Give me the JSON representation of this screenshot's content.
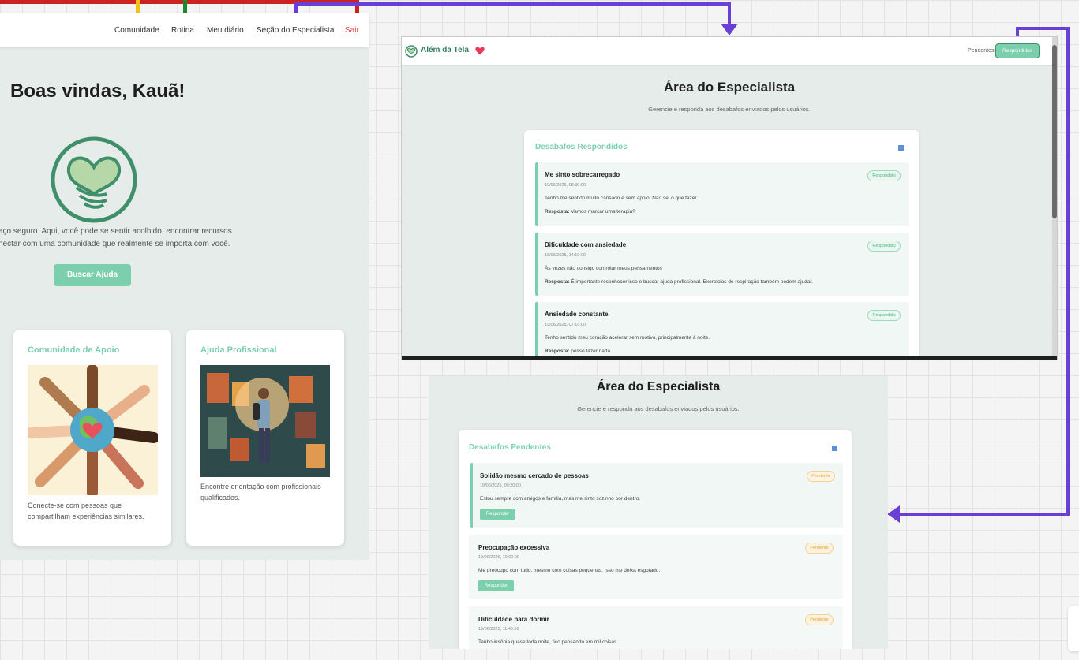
{
  "home": {
    "nav": {
      "comunidade": "Comunidade",
      "rotina": "Rotina",
      "diario": "Meu diário",
      "especialista": "Seção do Especialista",
      "sair": "Sair"
    },
    "title": "Boas vindas, Kauã!",
    "intro_line1": "aço seguro. Aqui, você pode se sentir acolhido, encontrar recursos",
    "intro_line2": "nectar com uma comunidade que realmente se importa com você.",
    "cta": "Buscar Ajuda",
    "cards": [
      {
        "title": "Comunidade de Apoio",
        "desc_line1": "Conecte-se com pessoas que",
        "desc_line2": "compartilham experiências similares."
      },
      {
        "title": "Ajuda Profissional",
        "desc_line1": "Encontre orientação com profissionais",
        "desc_line2": "qualificados."
      }
    ]
  },
  "specialist_answered": {
    "brand": "Além da Tela",
    "tab_pending": "Pendentes",
    "tab_answered": "Respondidos",
    "title": "Área do Especialista",
    "subtitle": "Gerencie e responda aos desabafos enviados pelos usuários.",
    "panel_title": "Desabafos Respondidos",
    "response_label": "Resposta:",
    "items": [
      {
        "title": "Me sinto sobrecarregado",
        "date": "19/06/2025, 08:30:00",
        "text": "Tenho me sentido muito cansado e sem apoio. Não sei o que fazer.",
        "response": "Vamos marcar uma terapia?",
        "status": "Respondido"
      },
      {
        "title": "Dificuldade com ansiedade",
        "date": "18/06/2025, 14:10:00",
        "text": "Às vezes não consigo controlar meus pensamentos",
        "response": "É importante reconhecer isso e buscar ajuda profissional. Exercícios de respiração também podem ajudar.",
        "status": "Respondido"
      },
      {
        "title": "Ansiedade constante",
        "date": "19/06/2025, 07:15:00",
        "text": "Tenho sentido meu coração acelerar sem motivo, principalmente à noite.",
        "response": "posso fazer nada",
        "status": "Respondido"
      }
    ]
  },
  "specialist_pending": {
    "title": "Área do Especialista",
    "subtitle": "Gerencie e responda aos desabafos enviados pelos usuários.",
    "panel_title": "Desabafos Pendentes",
    "reply_label": "Responder",
    "items": [
      {
        "title": "Solidão mesmo cercado de pessoas",
        "date": "19/06/2025, 09:20:00",
        "text": "Estou sempre com amigos e família, mas me sinto sozinho por dentro.",
        "status": "Pendente"
      },
      {
        "title": "Preocupação excessiva",
        "date": "19/06/2025, 10:00:00",
        "text": "Me preocupo com tudo, mesmo com coisas pequenas. Isso me deixa esgotado.",
        "status": "Pendente"
      },
      {
        "title": "Dificuldade para dormir",
        "date": "19/06/2025, 11:45:00",
        "text": "Tenho insônia quase toda noite, fico pensando em mil coisas.",
        "status": "Pendente"
      }
    ]
  },
  "colors": {
    "accent": "#7ccfae",
    "button": "#7bcfad",
    "connector": "#6a3fd6",
    "sair": "#e24b4b",
    "pending_badge": "#e0a53c"
  },
  "icons": [
    "heart-hands-logo",
    "heart-icon",
    "arrow-down-icon",
    "arrow-left-icon",
    "list-icon"
  ]
}
